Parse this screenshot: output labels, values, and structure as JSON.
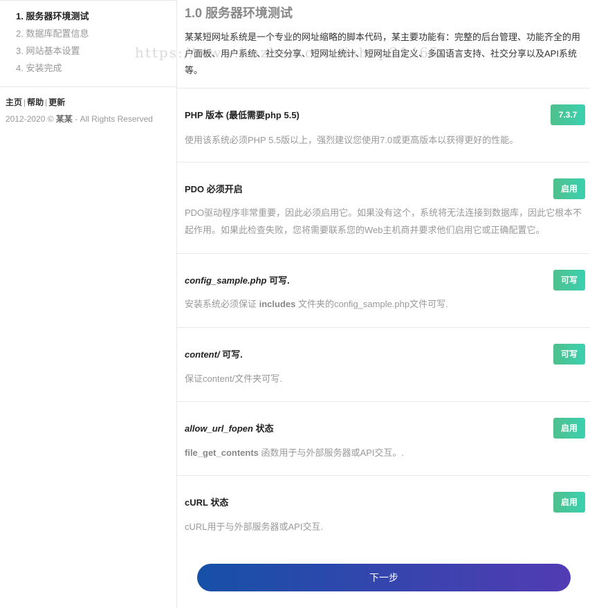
{
  "sidebar": {
    "steps": [
      {
        "label": "1. 服务器环境测试",
        "active": true
      },
      {
        "label": "2. 数据库配置信息",
        "active": false
      },
      {
        "label": "3. 网站基本设置",
        "active": false
      },
      {
        "label": "4. 安装完成",
        "active": false
      }
    ],
    "links": {
      "home": "主页",
      "help": "帮助",
      "update": "更新",
      "sep": "|"
    },
    "copyright_prefix": "2012-2020 © ",
    "copyright_brand": "某某",
    "copyright_suffix": " - All Rights Reserved"
  },
  "main": {
    "title": "1.0 服务器环境测试",
    "intro": "某某短网址系统是一个专业的网址缩略的脚本代码，某主要功能有：完整的后台管理、功能齐全的用户面板、用户系统、社交分享、短网址统计、短网址自定义、多国语言支持、社交分享以及API系统等。",
    "checks": [
      {
        "title_pre": "PHP 版本 (最低需要php 5.5)",
        "title_italic": "",
        "title_post": "",
        "status": "7.3.7",
        "desc_pre": "使用该系统必须PHP 5.5版以上，强烈建议您使用7.0或更高版本以获得更好的性能。",
        "desc_bold": "",
        "desc_post": ""
      },
      {
        "title_pre": "PDO 必须开启",
        "title_italic": "",
        "title_post": "",
        "status": "启用",
        "desc_pre": "PDO驱动程序非常重要，因此必须启用它。如果没有这个，系统将无法连接到数据库，因此它根本不起作用。如果此检查失败，您将需要联系您的Web主机商并要求他们启用它或正确配置它。",
        "desc_bold": "",
        "desc_post": ""
      },
      {
        "title_pre": "",
        "title_italic": "config_sample.php",
        "title_post": " 可写.",
        "status": "可写",
        "desc_pre": "安装系统必须保证 ",
        "desc_bold": "includes",
        "desc_post": " 文件夹的config_sample.php文件可写."
      },
      {
        "title_pre": "",
        "title_italic": "content/",
        "title_post": " 可写.",
        "status": "可写",
        "desc_pre": "保证content/文件夹可写.",
        "desc_bold": "",
        "desc_post": ""
      },
      {
        "title_pre": "",
        "title_italic": "allow_url_fopen",
        "title_post": " 状态",
        "status": "启用",
        "desc_pre": "",
        "desc_bold": "file_get_contents",
        "desc_post": " 函数用于与外部服务器或API交互。."
      },
      {
        "title_pre": "cURL 状态",
        "title_italic": "",
        "title_post": "",
        "status": "启用",
        "desc_pre": "cURL用于与外部服务器或API交互.",
        "desc_bold": "",
        "desc_post": ""
      }
    ],
    "next_button": "下一步"
  },
  "watermark": "https://www.huzhan.com/ishop31465",
  "colors": {
    "badge_start": "#4fc08d",
    "badge_end": "#3bd0b0",
    "button_start": "#1650a8",
    "button_end": "#523bb3"
  }
}
